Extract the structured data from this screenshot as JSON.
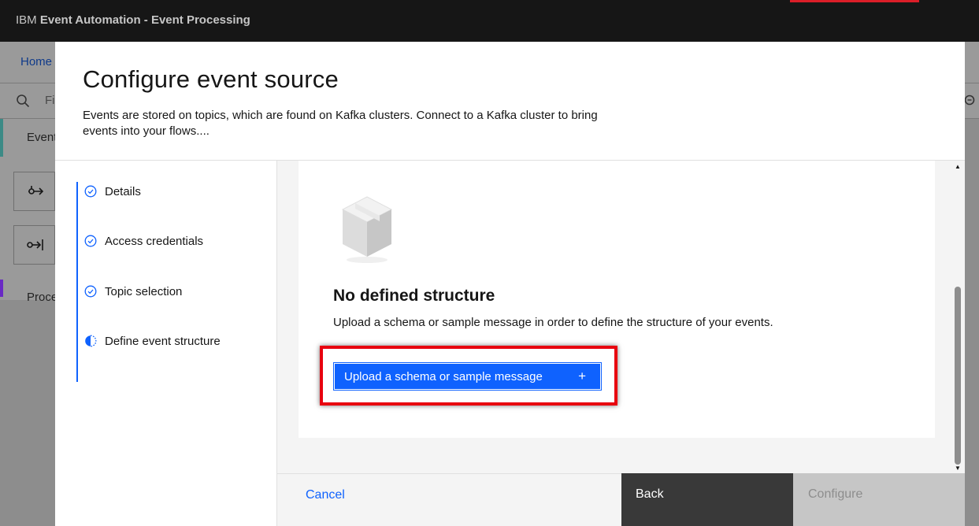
{
  "app": {
    "title_prefix": "IBM",
    "title_main": "Event Automation - Event Processing"
  },
  "background": {
    "breadcrumb_home": "Home",
    "filter_text": "Fi",
    "sidebar_tab": "Event",
    "processor_label": "Proce"
  },
  "modal": {
    "title": "Configure event source",
    "description": "Events are stored on topics, which are found on Kafka clusters. Connect to a Kafka cluster to bring events into your flows....",
    "steps": [
      {
        "label": "Details",
        "state": "complete"
      },
      {
        "label": "Access credentials",
        "state": "complete"
      },
      {
        "label": "Topic selection",
        "state": "complete"
      },
      {
        "label": "Define event structure",
        "state": "current"
      }
    ],
    "empty_state": {
      "title": "No defined structure",
      "description": "Upload a schema or sample message in order to define the structure of your events.",
      "button_label": "Upload a schema or sample message",
      "button_icon": "+"
    },
    "footer": {
      "cancel": "Cancel",
      "back": "Back",
      "configure": "Configure"
    }
  },
  "colors": {
    "primary": "#0f62fe",
    "highlight": "#e8000f",
    "header_bg": "#161616"
  }
}
